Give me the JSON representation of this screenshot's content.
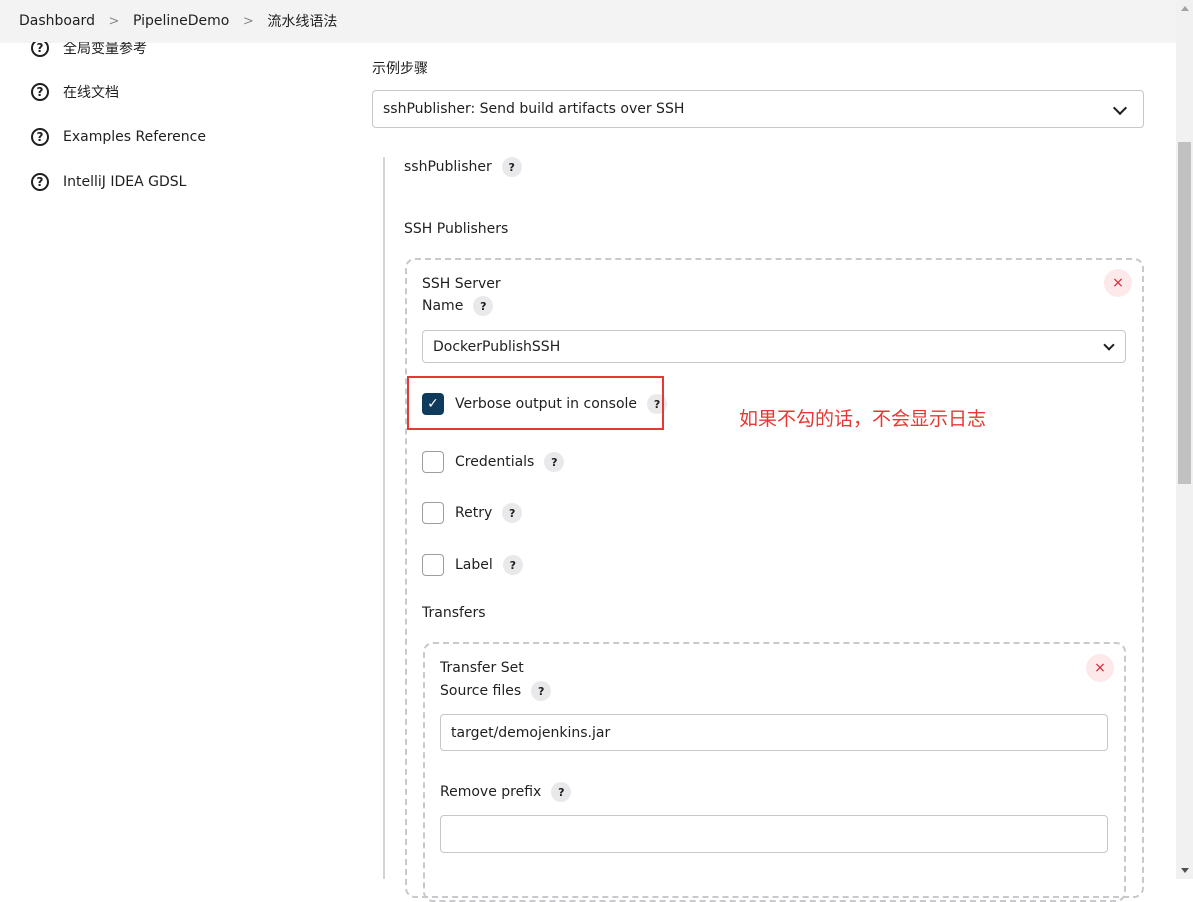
{
  "breadcrumb": [
    "Dashboard",
    "PipelineDemo",
    "流水线语法"
  ],
  "sidebar": {
    "items": [
      {
        "label": "全局变量参考",
        "icon": "help-circle-icon"
      },
      {
        "label": "在线文档",
        "icon": "help-circle-icon"
      },
      {
        "label": "Examples Reference",
        "icon": "help-circle-icon"
      },
      {
        "label": "IntelliJ IDEA GDSL",
        "icon": "help-circle-icon"
      }
    ]
  },
  "sample_step": {
    "label": "示例步骤",
    "selected": "sshPublisher: Send build artifacts over SSH"
  },
  "step": {
    "name": "sshPublisher",
    "publishers_label": "SSH Publishers",
    "server": {
      "title": "SSH Server",
      "name_label": "Name",
      "name_value": "DockerPublishSSH",
      "options": [
        {
          "label": "Verbose output in console",
          "checked": true
        },
        {
          "label": "Credentials",
          "checked": false
        },
        {
          "label": "Retry",
          "checked": false
        },
        {
          "label": "Label",
          "checked": false
        }
      ],
      "transfers_label": "Transfers",
      "transfer_set": {
        "title": "Transfer Set",
        "source_label": "Source files",
        "source_value": "target/demojenkins.jar",
        "remove_prefix_label": "Remove prefix",
        "remove_prefix_value": ""
      }
    }
  },
  "help_symbol": "?",
  "close_symbol": "×",
  "annotation": {
    "text": "如果不勾的话，不会显示日志",
    "color": "#e53935"
  },
  "colors": {
    "checkbox_checked": "#0e3a5c",
    "close_button_bg": "#fde8ea",
    "close_button_fg": "#d72638"
  }
}
